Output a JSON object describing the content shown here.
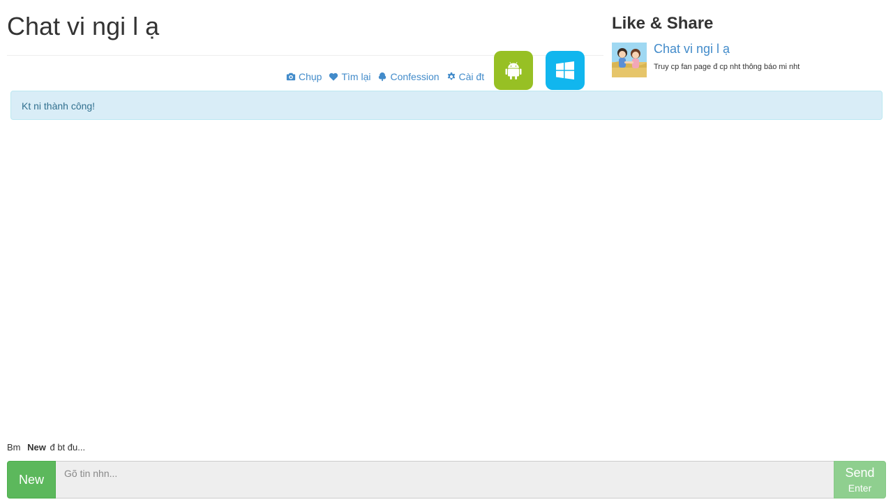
{
  "header": {
    "title": "Chat vi ngi l   ạ"
  },
  "menu": {
    "items": [
      {
        "label": "Chụp",
        "icon": "camera-icon"
      },
      {
        "label": "Tìm lại",
        "icon": "heart-icon"
      },
      {
        "label": "Confession",
        "icon": "tree-icon"
      },
      {
        "label": "Cài đt",
        "icon": "gear-icon"
      }
    ]
  },
  "apps": {
    "android": {
      "icon": "android-icon",
      "color": "#97c024"
    },
    "windows": {
      "icon": "windows-icon",
      "color": "#11b6ee"
    }
  },
  "sidebar": {
    "title": "Like & Share",
    "fanpage": {
      "name": "Chat vi ngi l   ạ",
      "description": "Truy cp fan page đ cp nht thông báo mi nht"
    }
  },
  "alert": {
    "text": "Kt ni thành công!"
  },
  "hint": {
    "prefix": "Bm",
    "keyword": "New",
    "suffix": "đ bt đu..."
  },
  "composer": {
    "new_label": "New",
    "placeholder": "Gõ tin nhn...",
    "send_label": "Send",
    "send_sub": "Enter"
  },
  "colors": {
    "link": "#428bca",
    "alert_bg": "#d9edf7",
    "alert_text": "#31708f",
    "new_button": "#5cb85c",
    "send_button": "#8fcf8f"
  }
}
